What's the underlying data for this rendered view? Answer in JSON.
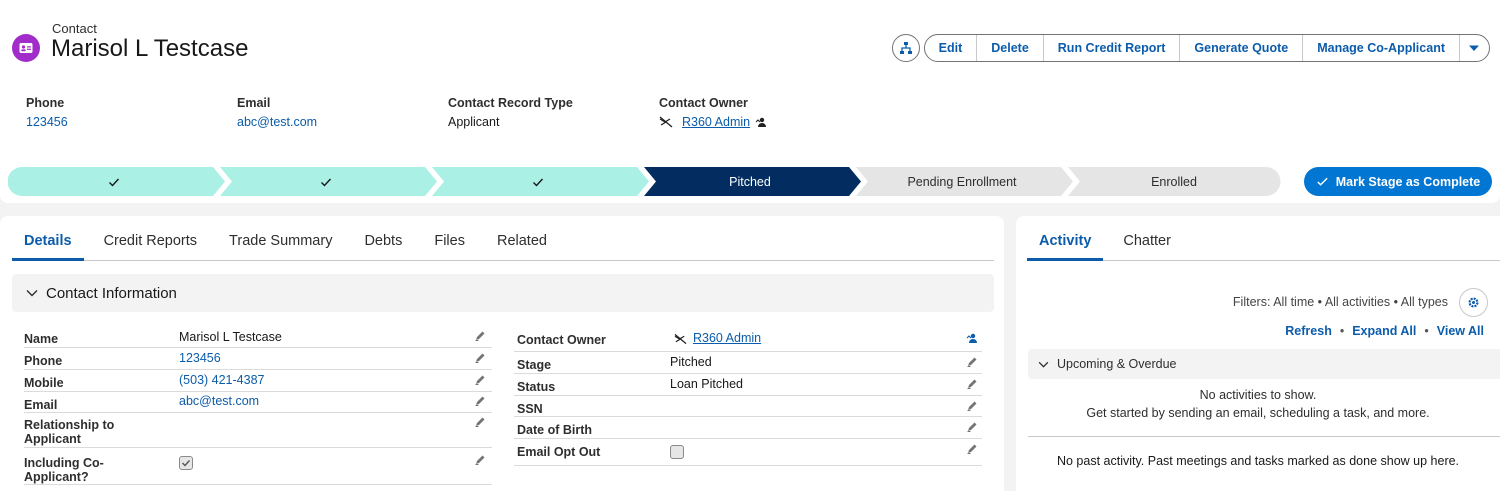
{
  "record": {
    "object_type": "Contact",
    "title": "Marisol L Testcase"
  },
  "actions": {
    "hierarchy_icon": "hierarchy-icon",
    "buttons": [
      "Edit",
      "Delete",
      "Run Credit Report",
      "Generate Quote",
      "Manage Co-Applicant"
    ],
    "menu_icon": "chevron-down-icon"
  },
  "highlights": {
    "phone_label": "Phone",
    "phone_value": "123456",
    "email_label": "Email",
    "email_value": "abc@test.com",
    "record_type_label": "Contact Record Type",
    "record_type_value": "Applicant",
    "owner_label": "Contact Owner",
    "owner_value": "R360 Admin"
  },
  "path": {
    "stages": [
      {
        "label": "",
        "state": "complete"
      },
      {
        "label": "",
        "state": "complete"
      },
      {
        "label": "",
        "state": "complete"
      },
      {
        "label": "Pitched",
        "state": "current"
      },
      {
        "label": "Pending Enrollment",
        "state": "incomplete"
      },
      {
        "label": "Enrolled",
        "state": "incomplete"
      }
    ],
    "mark_complete_label": "Mark Stage as Complete"
  },
  "tabs": [
    "Details",
    "Credit Reports",
    "Trade Summary",
    "Debts",
    "Files",
    "Related"
  ],
  "section": {
    "title": "Contact Information"
  },
  "fields_left": [
    {
      "label": "Name",
      "value": "Marisol L Testcase"
    },
    {
      "label": "Phone",
      "value": "123456"
    },
    {
      "label": "Mobile",
      "value": "(503) 421-4387"
    },
    {
      "label": "Email",
      "value": "abc@test.com"
    },
    {
      "label": "Relationship to Applicant",
      "value": ""
    },
    {
      "label": "Including Co-Applicant?",
      "value": ""
    }
  ],
  "fields_right": [
    {
      "label": "Contact Owner",
      "value": "R360 Admin"
    },
    {
      "label": "Stage",
      "value": "Pitched"
    },
    {
      "label": "Status",
      "value": "Loan Pitched"
    },
    {
      "label": "SSN",
      "value": ""
    },
    {
      "label": "Date of Birth",
      "value": ""
    },
    {
      "label": "Email Opt Out",
      "value": ""
    }
  ],
  "activity": {
    "tabs": [
      "Activity",
      "Chatter"
    ],
    "filters": "Filters: All time • All activities • All types",
    "links": [
      "Refresh",
      "Expand All",
      "View All"
    ],
    "upcoming_title": "Upcoming & Overdue",
    "empty_title": "No activities to show.",
    "empty_sub": "Get started by sending an email, scheduling a task, and more.",
    "past_text": "No past activity. Past meetings and tasks marked as done show up here."
  },
  "colors": {
    "accent": "#0b5cab",
    "brand_button": "#0176d3",
    "path_complete": "#aaf0e5",
    "path_current": "#032d60",
    "path_incomplete": "#e5e5e5",
    "object_icon": "#a12cc9"
  }
}
